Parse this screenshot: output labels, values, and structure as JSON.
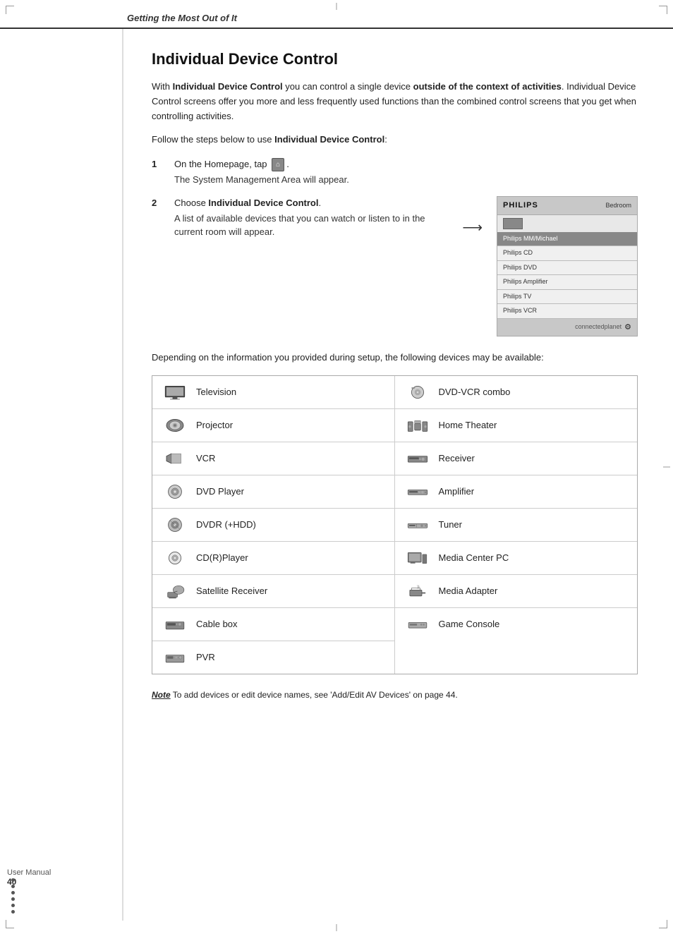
{
  "header": {
    "title": "Getting the Most Out of It"
  },
  "sidebar": {
    "page_label": "User Manual",
    "page_number": "40"
  },
  "main": {
    "title": "Individual Device Control",
    "intro": {
      "line1_prefix": "With ",
      "line1_bold1": "Individual Device Control",
      "line1_mid": " you can control a single device ",
      "line1_bold2": "outside of the context of activities",
      "line1_suffix": ". Individual Device Control screens offer you more and less frequently used functions than the combined control screens that you get when controlling activities.",
      "line2_prefix": "Follow the steps below to use ",
      "line2_bold": "Individual Device Control",
      "line2_suffix": ":"
    },
    "steps": [
      {
        "number": "1",
        "text_prefix": "On the Homepage, tap ",
        "text_icon": "[icon]",
        "text_suffix": ".",
        "subtext": "The System Management Area will appear."
      },
      {
        "number": "2",
        "text_prefix": "Choose ",
        "text_bold": "Individual Device Control",
        "text_suffix": ".",
        "subtext": "A list of available devices that you can watch or listen to in the current room will appear."
      }
    ],
    "philips_screen": {
      "logo": "PHILIPS",
      "room": "Bedroom",
      "items": [
        "Philips MM/Michael",
        "Philips CD",
        "Philips DVD",
        "Philips Amplifier",
        "Philips TV",
        "Philips VCR"
      ],
      "footer": "connectedplanet"
    },
    "depending_text": "Depending on the information you provided during setup, the following devices may be available:",
    "devices_left": [
      {
        "label": "Television",
        "icon": "tv"
      },
      {
        "label": "Projector",
        "icon": "projector"
      },
      {
        "label": "VCR",
        "icon": "vcr"
      },
      {
        "label": "DVD Player",
        "icon": "dvd"
      },
      {
        "label": "DVDR (+HDD)",
        "icon": "dvdr"
      },
      {
        "label": "CD(R)Player",
        "icon": "cd"
      },
      {
        "label": "Satellite Receiver",
        "icon": "satellite"
      },
      {
        "label": "Cable box",
        "icon": "cablebox"
      },
      {
        "label": "PVR",
        "icon": "pvr"
      }
    ],
    "devices_right": [
      {
        "label": "DVD-VCR combo",
        "icon": "dvdvcr"
      },
      {
        "label": "Home Theater",
        "icon": "hometheater"
      },
      {
        "label": "Receiver",
        "icon": "receiver"
      },
      {
        "label": "Amplifier",
        "icon": "amplifier"
      },
      {
        "label": "Tuner",
        "icon": "tuner"
      },
      {
        "label": "Media Center PC",
        "icon": "mediapc"
      },
      {
        "label": "Media Adapter",
        "icon": "mediaadapter"
      },
      {
        "label": "Game Console",
        "icon": "gameconsole"
      }
    ],
    "note": {
      "bold": "Note",
      "text": " To add devices or edit device names, see 'Add/Edit AV Devices' on page 44."
    }
  }
}
